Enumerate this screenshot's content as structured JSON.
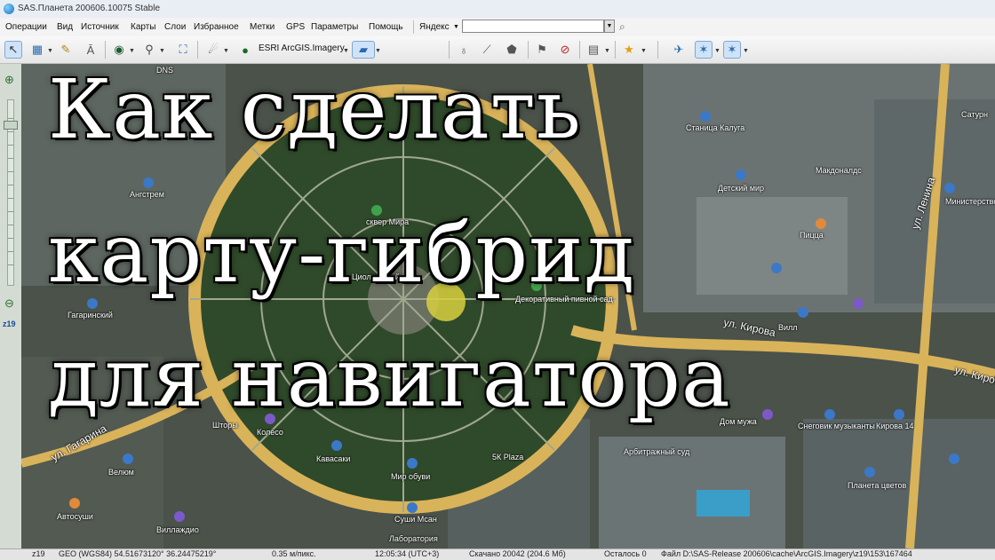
{
  "window": {
    "title": "SAS.Планета 200606.10075 Stable"
  },
  "menu": {
    "items": [
      "Операции",
      "Вид",
      "Источник",
      "Карты",
      "Слои",
      "Избранное",
      "Метки",
      "GPS",
      "Параметры",
      "Помощь"
    ],
    "search_provider": "Яндекс"
  },
  "toolbar": {
    "map_source": "ESRI ArcGIS.Imagery"
  },
  "zoom_panel": {
    "level": "z19"
  },
  "headline": {
    "line1": "Как сделать",
    "line2": "карту-гибрид",
    "line3": "для навигатора"
  },
  "map": {
    "streets": [
      "ул. Кирова",
      "ул. Кирова",
      "ул. Гагарина",
      "ул. Ленина"
    ],
    "pois": [
      "DNS",
      "Сатурн",
      "Ангстрем",
      "сквер Мира",
      "Циолковский",
      "Декоративный пивной сад",
      "Гагаринский",
      "Пицца",
      "Макдоналдс",
      "Детский мир",
      "Министерство лесного хозяйства",
      "Шторы",
      "Колесо",
      "Кавасаки",
      "Мир обуви",
      "5К Plaza",
      "Арбитражный суд",
      "Снеговик музыканты",
      "Кирова 14",
      "Велюм",
      "Автосуши",
      "Виллаждио",
      "Лаборатория",
      "Планета цветов",
      "Дом мужа",
      "Вилл",
      "Суши Мсан",
      "Станица Калуга"
    ]
  },
  "status": {
    "zoom": "z19",
    "coords": "GEO (WGS84) 54.51673120° 36.24475219°",
    "scale": "0.35 м/пикс.",
    "time": "12:05:34 (UTC+3)",
    "downloaded": "Скачано 20042 (204.6 Мб)",
    "remaining": "Осталось 0",
    "file": "Файл D:\\SAS-Release 200606\\cache\\ArcGIS.Imagery\\z19\\153\\167464"
  },
  "colors": {
    "road": "#d9b35a",
    "vegetation": "#2f4a2a",
    "building": "#6f7878",
    "poi_blue": "#3b78c8",
    "poi_green": "#3fa34d",
    "poi_orange": "#e08a3a",
    "poi_purple": "#7b5ac8"
  }
}
